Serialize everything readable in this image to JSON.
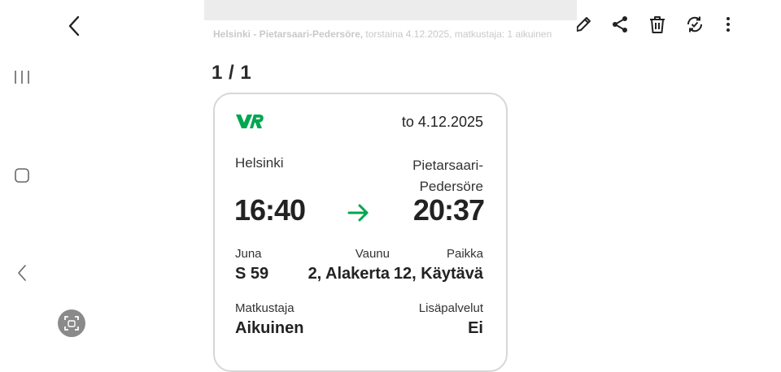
{
  "viewer": {
    "pager": "1 / 1",
    "header_line_bold": "Helsinki - Pietarsaari-Pedersöre,",
    "header_line_rest": " torstaina 4.12.2025, matkustaja: 1 aikuinen"
  },
  "ticket": {
    "operator": "VR",
    "date": "to 4.12.2025",
    "from_station": "Helsinki",
    "to_station_line1": "Pietarsaari-",
    "to_station_line2": "Pedersöre",
    "departure_time": "16:40",
    "arrival_time": "20:37",
    "train_label": "Juna",
    "train_value": "S 59",
    "car_label": "Vaunu",
    "car_value": "2, Alakerta",
    "seat_label": "Paikka",
    "seat_value": "12, Käytävä",
    "passenger_label": "Matkustaja",
    "passenger_value": "Aikuinen",
    "extras_label": "Lisäpalvelut",
    "extras_value": "Ei"
  },
  "colors": {
    "accent_green": "#00a651",
    "card_border": "#d7d7d7",
    "capture_button": "#8a8a8a"
  },
  "icons": [
    "back-icon",
    "heart-icon",
    "edit-icon",
    "share-icon",
    "delete-icon",
    "rotate-icon",
    "more-icon",
    "recents-icon",
    "home-icon",
    "system-back-icon",
    "capture-icon"
  ]
}
